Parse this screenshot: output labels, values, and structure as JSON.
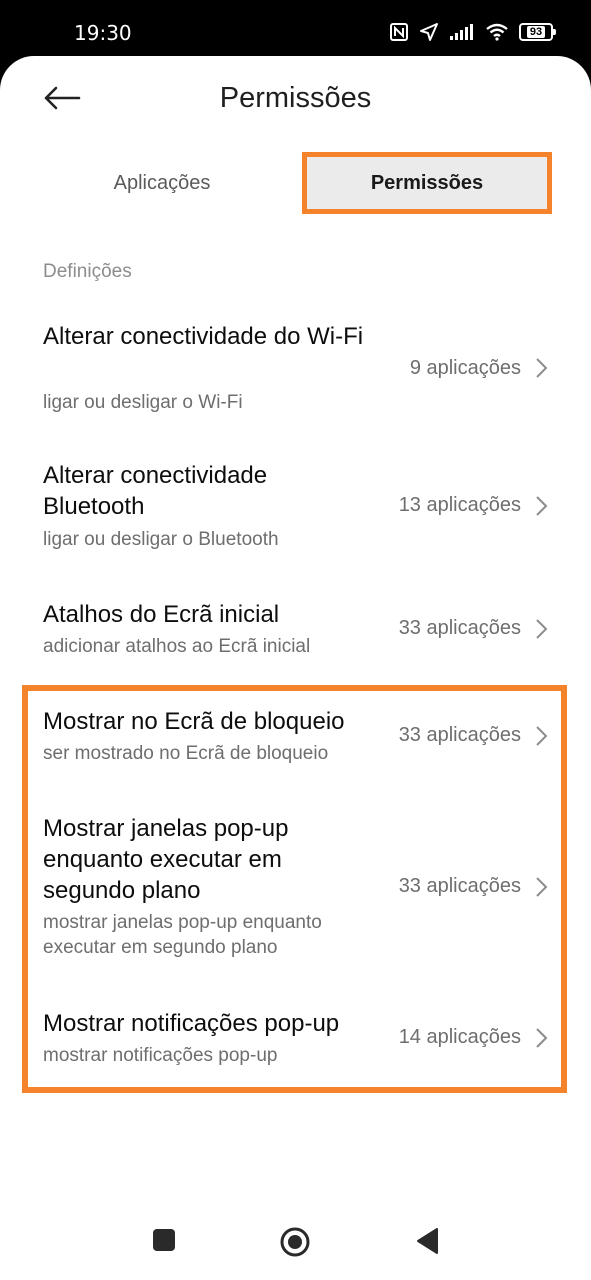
{
  "status_bar": {
    "time": "19:30",
    "battery": "93",
    "icons": [
      "nfc-icon",
      "location-arrow-icon",
      "signal-icon",
      "wifi-icon",
      "battery-icon"
    ]
  },
  "header": {
    "back_icon": "back-arrow-icon",
    "title": "Permissões"
  },
  "tabs": [
    {
      "label": "Aplicações",
      "selected": false
    },
    {
      "label": "Permissões",
      "selected": true
    }
  ],
  "section": {
    "label": "Definições"
  },
  "items": [
    {
      "title": "Alterar conectividade do Wi-Fi",
      "subtitle": "ligar ou desligar o Wi-Fi",
      "count": "9 aplicações"
    },
    {
      "title": "Alterar conectividade Bluetooth",
      "subtitle": "ligar ou desligar o Bluetooth",
      "count": "13 aplicações"
    },
    {
      "title": "Atalhos do Ecrã inicial",
      "subtitle": "adicionar atalhos ao Ecrã inicial",
      "count": "33 aplicações"
    },
    {
      "title": "Mostrar no Ecrã de bloqueio",
      "subtitle": "ser mostrado no Ecrã de bloqueio",
      "count": "33 aplicações"
    },
    {
      "title": "Mostrar janelas pop-up enquanto executar em segundo plano",
      "subtitle": "mostrar janelas pop-up enquanto executar em segundo plano",
      "count": "33 aplicações"
    },
    {
      "title": "Mostrar notificações pop-up",
      "subtitle": "mostrar notificações pop-up",
      "count": "14 aplicações"
    }
  ],
  "highlight_color": "#f5832c",
  "nav_bar": {
    "buttons": [
      "recents-square-icon",
      "home-circle-icon",
      "back-triangle-icon"
    ]
  }
}
